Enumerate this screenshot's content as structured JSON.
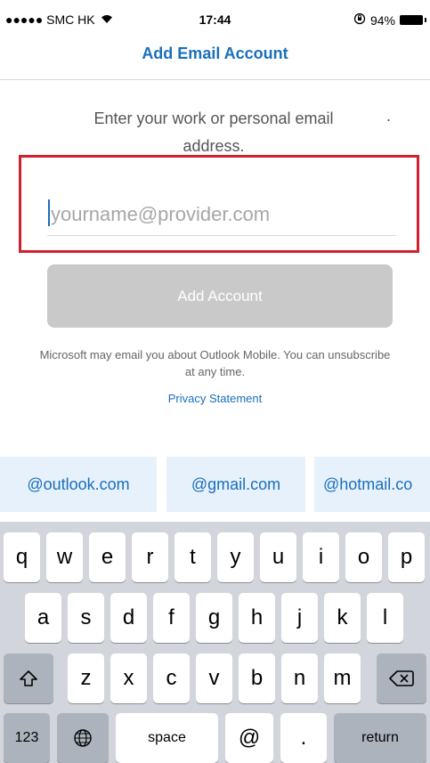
{
  "status_bar": {
    "carrier": "●●●●● SMC HK",
    "time": "17:44",
    "battery_percent": "94%"
  },
  "nav": {
    "title": "Add Email Account"
  },
  "instruction": {
    "line": "Enter your work or personal email address.",
    "trailing_dot": "."
  },
  "email_field": {
    "value": "",
    "placeholder": "yourname@provider.com"
  },
  "add_account_button": {
    "label": "Add Account",
    "enabled": false
  },
  "disclaimer": {
    "text": "Microsoft may email you about Outlook Mobile. You can unsubscribe at any time."
  },
  "privacy_link": {
    "label": "Privacy Statement"
  },
  "domain_suggestions": [
    "@outlook.com",
    "@gmail.com",
    "@hotmail.co"
  ],
  "keyboard": {
    "row1": [
      "q",
      "w",
      "e",
      "r",
      "t",
      "y",
      "u",
      "i",
      "o",
      "p"
    ],
    "row2": [
      "a",
      "s",
      "d",
      "f",
      "g",
      "h",
      "j",
      "k",
      "l"
    ],
    "row3": [
      "z",
      "x",
      "c",
      "v",
      "b",
      "n",
      "m"
    ],
    "numbers_label": "123",
    "space_label": "space",
    "at_label": "@",
    "dot_label": ".",
    "return_label": "return"
  },
  "colors": {
    "accent": "#1a6fbf",
    "highlight_border": "#d3202e",
    "disabled_button": "#c9c9c9",
    "chip_background": "#e7f1fb",
    "keyboard_background": "#d2d5db"
  }
}
